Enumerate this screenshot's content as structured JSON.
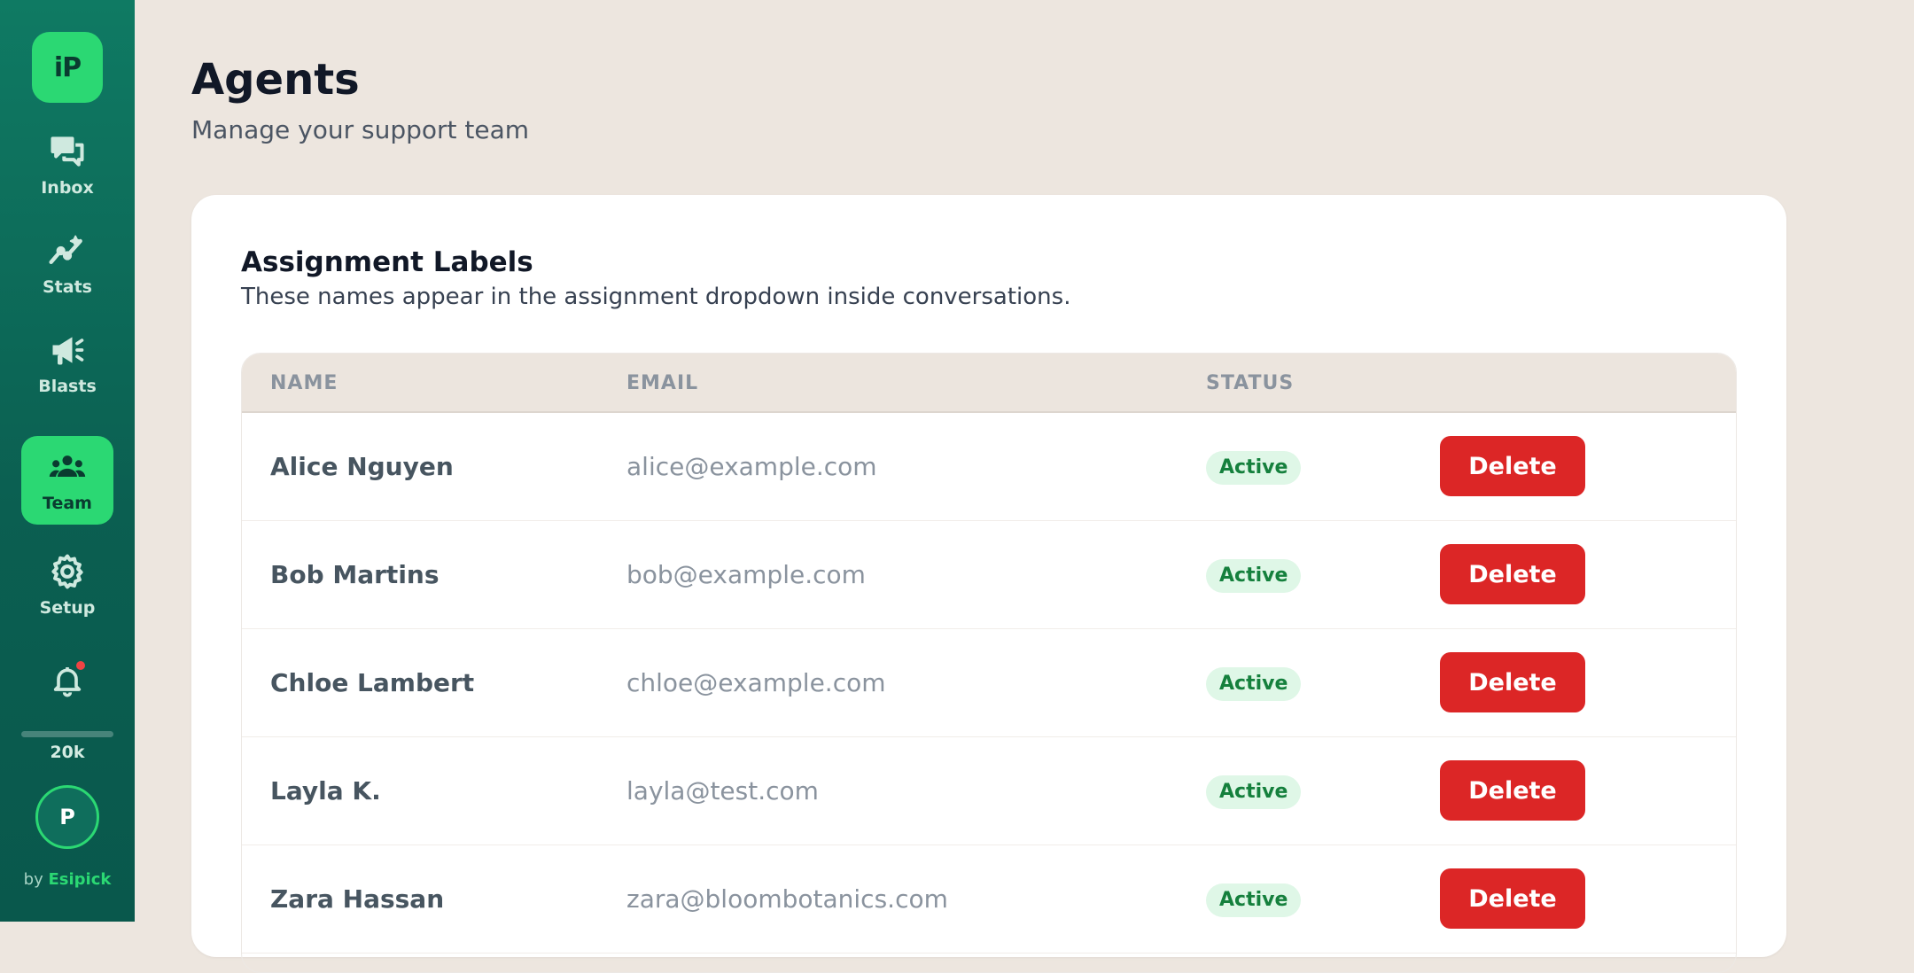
{
  "sidebar": {
    "logo": "iP",
    "nav": [
      {
        "label": "Inbox",
        "icon": "chat-icon"
      },
      {
        "label": "Stats",
        "icon": "chart-icon"
      },
      {
        "label": "Blasts",
        "icon": "megaphone-icon"
      },
      {
        "label": "Team",
        "icon": "team-icon",
        "active": true
      },
      {
        "label": "Setup",
        "icon": "gear-icon"
      }
    ],
    "usage": {
      "label": "20k",
      "fraction": 0.0
    },
    "avatar_initial": "P",
    "brand": {
      "prefix": "by",
      "name": "Esipick"
    }
  },
  "page": {
    "title": "Agents",
    "subtitle": "Manage your support team"
  },
  "card": {
    "title": "Assignment Labels",
    "description": "These names appear in the assignment dropdown inside conversations."
  },
  "table": {
    "columns": {
      "name": "NAME",
      "email": "EMAIL",
      "status": "STATUS"
    },
    "delete_label": "Delete",
    "rows": [
      {
        "name": "Alice Nguyen",
        "email": "alice@example.com",
        "status": "Active"
      },
      {
        "name": "Bob Martins",
        "email": "bob@example.com",
        "status": "Active"
      },
      {
        "name": "Chloe Lambert",
        "email": "chloe@example.com",
        "status": "Active"
      },
      {
        "name": "Layla K.",
        "email": "layla@test.com",
        "status": "Active"
      },
      {
        "name": "Zara Hassan",
        "email": "zara@bloombotanics.com",
        "status": "Active"
      }
    ]
  },
  "colors": {
    "sidebar": "#0b5f51",
    "accent": "#2bd873",
    "danger": "#dc2626",
    "background": "#ede6df"
  }
}
